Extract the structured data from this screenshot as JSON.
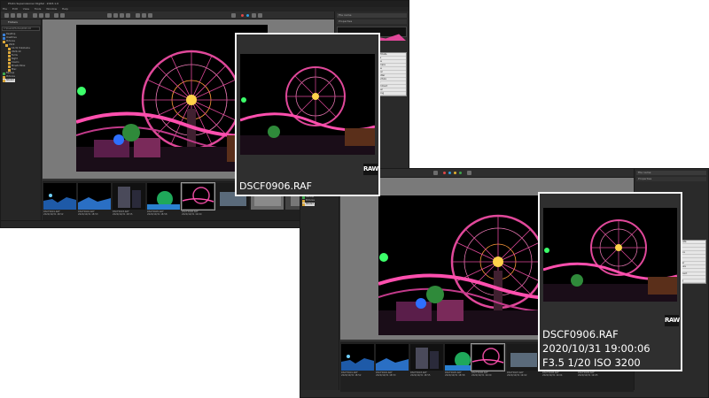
{
  "window": {
    "title": "Photo Supervisioner Digital · 2023.1.0",
    "menu": [
      "File",
      "Edit",
      "View",
      "Tools",
      "Window",
      "Help"
    ]
  },
  "toolbar": {
    "search_value": "File name"
  },
  "folder_panel": {
    "title": "Folders",
    "path": "C:\\Users\\Photos\\2020-10",
    "tree": [
      "Desktop",
      "OneDrive",
      "Pictures",
      "2020",
      "10-31 Yokohama",
      "2020-10",
      "Ferris",
      "Night",
      "Cosmo",
      "Minato Mirai",
      "Misc",
      "Backup",
      "Pictures",
      "Shared"
    ]
  },
  "filmstrip": {
    "items": [
      {
        "line1": "DSCF0901.RAF",
        "line2": "2020/10/31 18:52"
      },
      {
        "line1": "DSCF0902.RAF",
        "line2": "2020/10/31 18:53"
      },
      {
        "line1": "DSCF0903.RAF",
        "line2": "2020/10/31 18:55"
      },
      {
        "line1": "DSCF0905.RAF",
        "line2": "2020/10/31 18:58"
      },
      {
        "line1": "DSCF0906.RAF",
        "line2": "2020/10/31 19:00"
      },
      {
        "line1": "DSCF0907.RAF",
        "line2": "2020/10/31 19:02"
      },
      {
        "line1": "DSCF0908.RAF",
        "line2": "2020/10/31 19:04"
      },
      {
        "line1": "DSCF0909.RAF",
        "line2": "2020/10/31 19:05"
      }
    ]
  },
  "side_panel": {
    "header": "File name",
    "tab": "Properties",
    "props": [
      "Exif Data",
      "Size",
      "Date",
      "Camera",
      "Lens",
      "Focal",
      "Shutter",
      "Aperture",
      "ISO",
      "Comment",
      "Label",
      "Rating"
    ]
  },
  "tooltip_top": {
    "filename": "DSCF0906.RAF",
    "badge": "RAW"
  },
  "tooltip_bottom": {
    "filename": "DSCF0906.RAF",
    "datetime": "2020/10/31 19:00:06",
    "exposure": "F3.5 1/20 ISO 3200",
    "badge": "RAW"
  },
  "colors": {
    "accent_magenta": "#e0489a",
    "raw_badge_bg": "#141414",
    "viewer_bg": "#7a7a7a"
  }
}
